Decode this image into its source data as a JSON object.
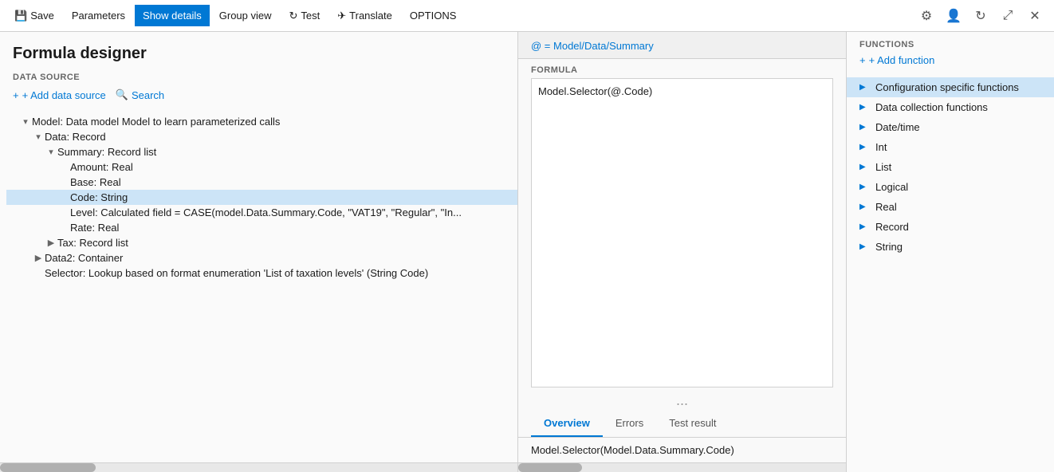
{
  "titlebar": {
    "save_label": "Save",
    "parameters_label": "Parameters",
    "show_details_label": "Show details",
    "group_view_label": "Group view",
    "test_label": "Test",
    "translate_label": "Translate",
    "options_label": "OPTIONS"
  },
  "left_panel": {
    "title": "Formula designer",
    "data_source_label": "DATA SOURCE",
    "add_data_source_label": "+ Add data source",
    "search_label": "Search",
    "tree_items": [
      {
        "id": "model",
        "text": "Model: Data model Model to learn parameterized calls",
        "indent": 1,
        "arrow": "▾",
        "selected": false
      },
      {
        "id": "data",
        "text": "Data: Record",
        "indent": 2,
        "arrow": "▾",
        "selected": false
      },
      {
        "id": "summary",
        "text": "Summary: Record list",
        "indent": 3,
        "arrow": "▾",
        "selected": false
      },
      {
        "id": "amount",
        "text": "Amount: Real",
        "indent": 4,
        "arrow": "",
        "selected": false
      },
      {
        "id": "base",
        "text": "Base: Real",
        "indent": 4,
        "arrow": "",
        "selected": false
      },
      {
        "id": "code",
        "text": "Code: String",
        "indent": 4,
        "arrow": "",
        "selected": true
      },
      {
        "id": "level",
        "text": "Level: Calculated field = CASE(model.Data.Summary.Code, \"VAT19\", \"Regular\", \"In...",
        "indent": 4,
        "arrow": "",
        "selected": false
      },
      {
        "id": "rate",
        "text": "Rate: Real",
        "indent": 4,
        "arrow": "",
        "selected": false
      },
      {
        "id": "tax",
        "text": "Tax: Record list",
        "indent": 3,
        "arrow": "▶",
        "selected": false
      },
      {
        "id": "data2",
        "text": "Data2: Container",
        "indent": 2,
        "arrow": "▶",
        "selected": false
      },
      {
        "id": "selector",
        "text": "Selector: Lookup based on format enumeration 'List of taxation levels' (String Code)",
        "indent": 2,
        "arrow": "",
        "selected": false
      }
    ]
  },
  "middle_panel": {
    "formula_path": "@ = Model/Data/Summary",
    "formula_label": "FORMULA",
    "formula_text": "Model.Selector(@.Code)",
    "dots": "...",
    "tabs": [
      "Overview",
      "Errors",
      "Test result"
    ],
    "active_tab": "Overview",
    "result_text": "Model.Selector(Model.Data.Summary.Code)"
  },
  "right_panel": {
    "functions_label": "FUNCTIONS",
    "add_function_label": "+ Add function",
    "function_items": [
      {
        "text": "Configuration specific functions",
        "selected": true
      },
      {
        "text": "Data collection functions",
        "selected": false
      },
      {
        "text": "Date/time",
        "selected": false
      },
      {
        "text": "Int",
        "selected": false
      },
      {
        "text": "List",
        "selected": false
      },
      {
        "text": "Logical",
        "selected": false
      },
      {
        "text": "Real",
        "selected": false
      },
      {
        "text": "Record",
        "selected": false
      },
      {
        "text": "String",
        "selected": false
      }
    ]
  }
}
